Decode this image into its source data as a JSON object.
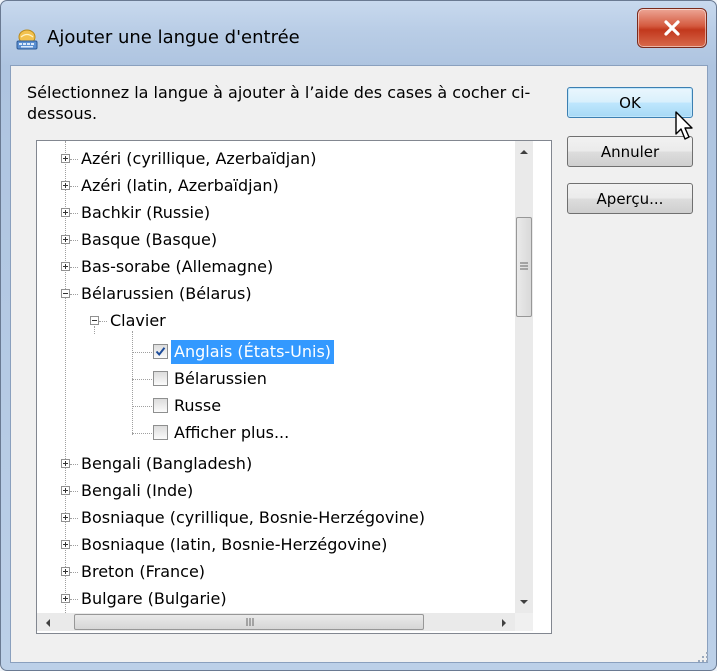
{
  "window": {
    "title": "Ajouter une langue d'entrée",
    "close_label": "X"
  },
  "instruction": "Sélectionnez la langue à ajouter à l’aide des cases à cocher ci-dessous.",
  "buttons": {
    "ok": "OK",
    "cancel": "Annuler",
    "preview": "Aperçu..."
  },
  "tree": {
    "before": [
      "Azéri (cyrillique, Azerbaïdjan)",
      "Azéri (latin, Azerbaïdjan)",
      "Bachkir (Russie)",
      "Basque (Basque)",
      "Bas-sorabe (Allemagne)"
    ],
    "expanded_language": "Bélarussien (Bélarus)",
    "group": "Clavier",
    "keyboards": [
      {
        "label": "Anglais (États-Unis)",
        "checked": true,
        "selected": true
      },
      {
        "label": "Bélarussien",
        "checked": false,
        "selected": false
      },
      {
        "label": "Russe",
        "checked": false,
        "selected": false
      },
      {
        "label": "Afficher plus...",
        "checked": false,
        "selected": false
      }
    ],
    "after": [
      "Bengali (Bangladesh)",
      "Bengali (Inde)",
      "Bosniaque (cyrillique, Bosnie-Herzégovine)",
      "Bosniaque (latin, Bosnie-Herzégovine)",
      "Breton (France)",
      "Bulgare (Bulgarie)"
    ]
  },
  "colors": {
    "selection": "#3399ff",
    "ok_border": "#3c7fb1",
    "close_red": "#c2381d"
  },
  "icons": {
    "title": "keyboard-globe-icon",
    "cursor": "mouse-pointer-icon"
  }
}
